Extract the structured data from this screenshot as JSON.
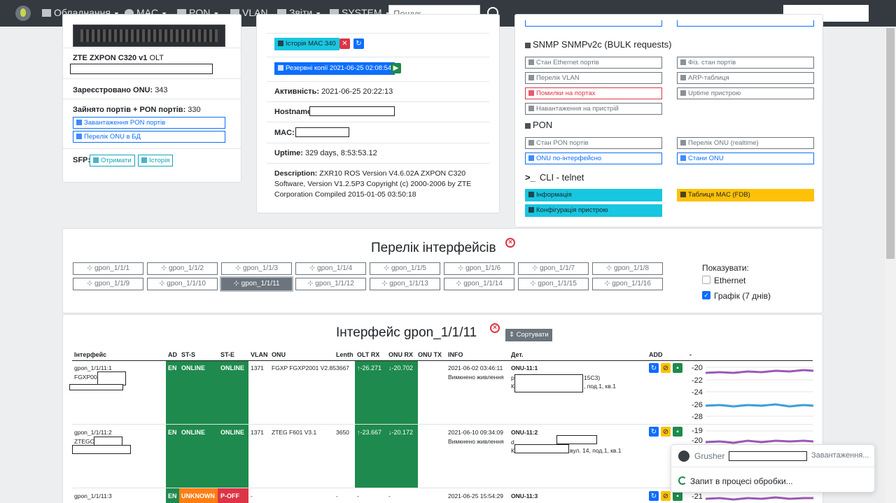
{
  "nav": {
    "items": [
      "Обладнання",
      "MAC",
      "PON",
      "VLAN",
      "Звіти",
      "SYSTEM"
    ],
    "search_placeholder": "Пошук"
  },
  "device": {
    "model": "ZTE ZXPON C320 v1",
    "type": "OLT",
    "registered_label": "Зареєстровано ONU:",
    "registered_value": "343",
    "ports_label": "Зайнято портів + PON портів:",
    "ports_value": "330",
    "btn_pon_load": "Завантаження PON портів",
    "btn_onu_list": "Перелік ONU в БД",
    "sfp_label": "SFP:",
    "btn_get": "Отримати",
    "btn_history": "Історія"
  },
  "info": {
    "btn_mac_history": "Історія MAC 340",
    "btn_backups": "Резервні копії 2021-06-25 02:08:54",
    "activity_label": "Активність:",
    "activity_value": "2021-06-25 20:22:13",
    "hostname_label": "Hostname",
    "mac_label": "MAC:",
    "uptime_label": "Uptime:",
    "uptime_value": "329 days, 8:53:53.12",
    "desc_label": "Description:",
    "desc_line1": "ZXR10 ROS Version V4.6.02A ZXPON C320",
    "desc_line2": "Software, Version V1.2.5P3 Copyright (c) 2000-2006 by ZTE",
    "desc_line3": "Corporation Compiled 2015-01-05 03:50:18"
  },
  "snmp": {
    "title": "SNMP SNMPv2c (BULK requests)",
    "btn_eth_state": "Стан Ethernet портів",
    "btn_phys_state": "Фіз. стан портів",
    "btn_vlan_list": "Перелік VLAN",
    "btn_arp": "ARP-таблиця",
    "btn_port_errors": "Помилки на портах",
    "btn_uptime": "Uptime пристрою",
    "btn_load": "Навантаження на пристрій",
    "pon_title": "PON",
    "btn_pon_state": "Стан PON портів",
    "btn_onu_realtime": "Перелік ONU (realtime)",
    "btn_onu_iface": "ONU по-інтерфейсно",
    "btn_onu_states": "Стани ONU",
    "cli_title": "CLI - telnet",
    "btn_info": "Інформація",
    "btn_mac_table": "Таблиця MAC (FDB)",
    "btn_config": "Конфігурація пристрою"
  },
  "interfaces": {
    "title": "Перелік інтерфейсів",
    "items": [
      "gpon_1/1/1",
      "gpon_1/1/2",
      "gpon_1/1/3",
      "gpon_1/1/4",
      "gpon_1/1/5",
      "gpon_1/1/6",
      "gpon_1/1/7",
      "gpon_1/1/8",
      "gpon_1/1/9",
      "gpon_1/1/10",
      "gpon_1/1/11",
      "gpon_1/1/12",
      "gpon_1/1/13",
      "gpon_1/1/14",
      "gpon_1/1/15",
      "gpon_1/1/16"
    ],
    "active": "gpon_1/1/11",
    "show_label": "Показувати:",
    "opt_ethernet": "Ethernet",
    "opt_graph": "Графік (7 днів)"
  },
  "iface_table": {
    "title": "Інтерфейс gpon_1/1/11",
    "sort_btn": "Сортувати",
    "headers": [
      "Інтерфейс",
      "AD",
      "ST-S",
      "ST-E",
      "VLAN",
      "ONU",
      "Lenth",
      "OLT RX",
      "ONU RX",
      "ONU TX",
      "INFO",
      "Дет.",
      "ADD",
      "-"
    ],
    "rows": [
      {
        "iface": "gpon_1/1/11:1",
        "serial": "FGXP004",
        "ad": "EN",
        "sts": "ONLINE",
        "ste": "ONLINE",
        "vlan": "1371",
        "onu": "FGXP FGXP2001 V2.85",
        "len": "3667",
        "olt_rx": "-26.271",
        "onu_rx": "-20.702",
        "onu_tx": "",
        "info_time": "2021-06-02 03:46:11",
        "info_text": "Вимкнено живлення",
        "det_title": "ONU-11:1",
        "det_line1": "р",
        "det_line1b": "15C3)",
        "det_line2": "К",
        "det_line2b": ", под.1, кв.1",
        "axis": [
          "-20",
          "-22",
          "-24",
          "-26",
          "-28"
        ]
      },
      {
        "iface": "gpon_1/1/11:2",
        "serial": "ZTEGC",
        "ad": "EN",
        "sts": "ONLINE",
        "ste": "ONLINE",
        "vlan": "1371",
        "onu": "ZTEG F601 V3.1",
        "len": "3650",
        "olt_rx": "-23.667",
        "onu_rx": "-20.172",
        "onu_tx": "",
        "info_time": "2021-06-10 09:34:09",
        "info_text": "Вимкнено живлення",
        "det_title": "ONU-11:2",
        "det_line1": "d",
        "det_line2": "К",
        "det_line2b": "вул. 14, под.1, кв.1",
        "axis": [
          "-19",
          "-20"
        ]
      },
      {
        "iface": "gpon_1/1/11:3",
        "ad": "EN",
        "sts": "UNKNOWN",
        "ste": "P-OFF",
        "vlan": "-",
        "len": "-",
        "olt_rx": "-",
        "onu_rx": "-",
        "info_time": "2021-06-25 15:54:29",
        "det_title": "ONU-11:3",
        "axis": [
          "-21"
        ]
      }
    ]
  },
  "toast": {
    "app_name": "Grusher",
    "status": "Завантаження...",
    "message": "Запит в процесі обробки..."
  }
}
